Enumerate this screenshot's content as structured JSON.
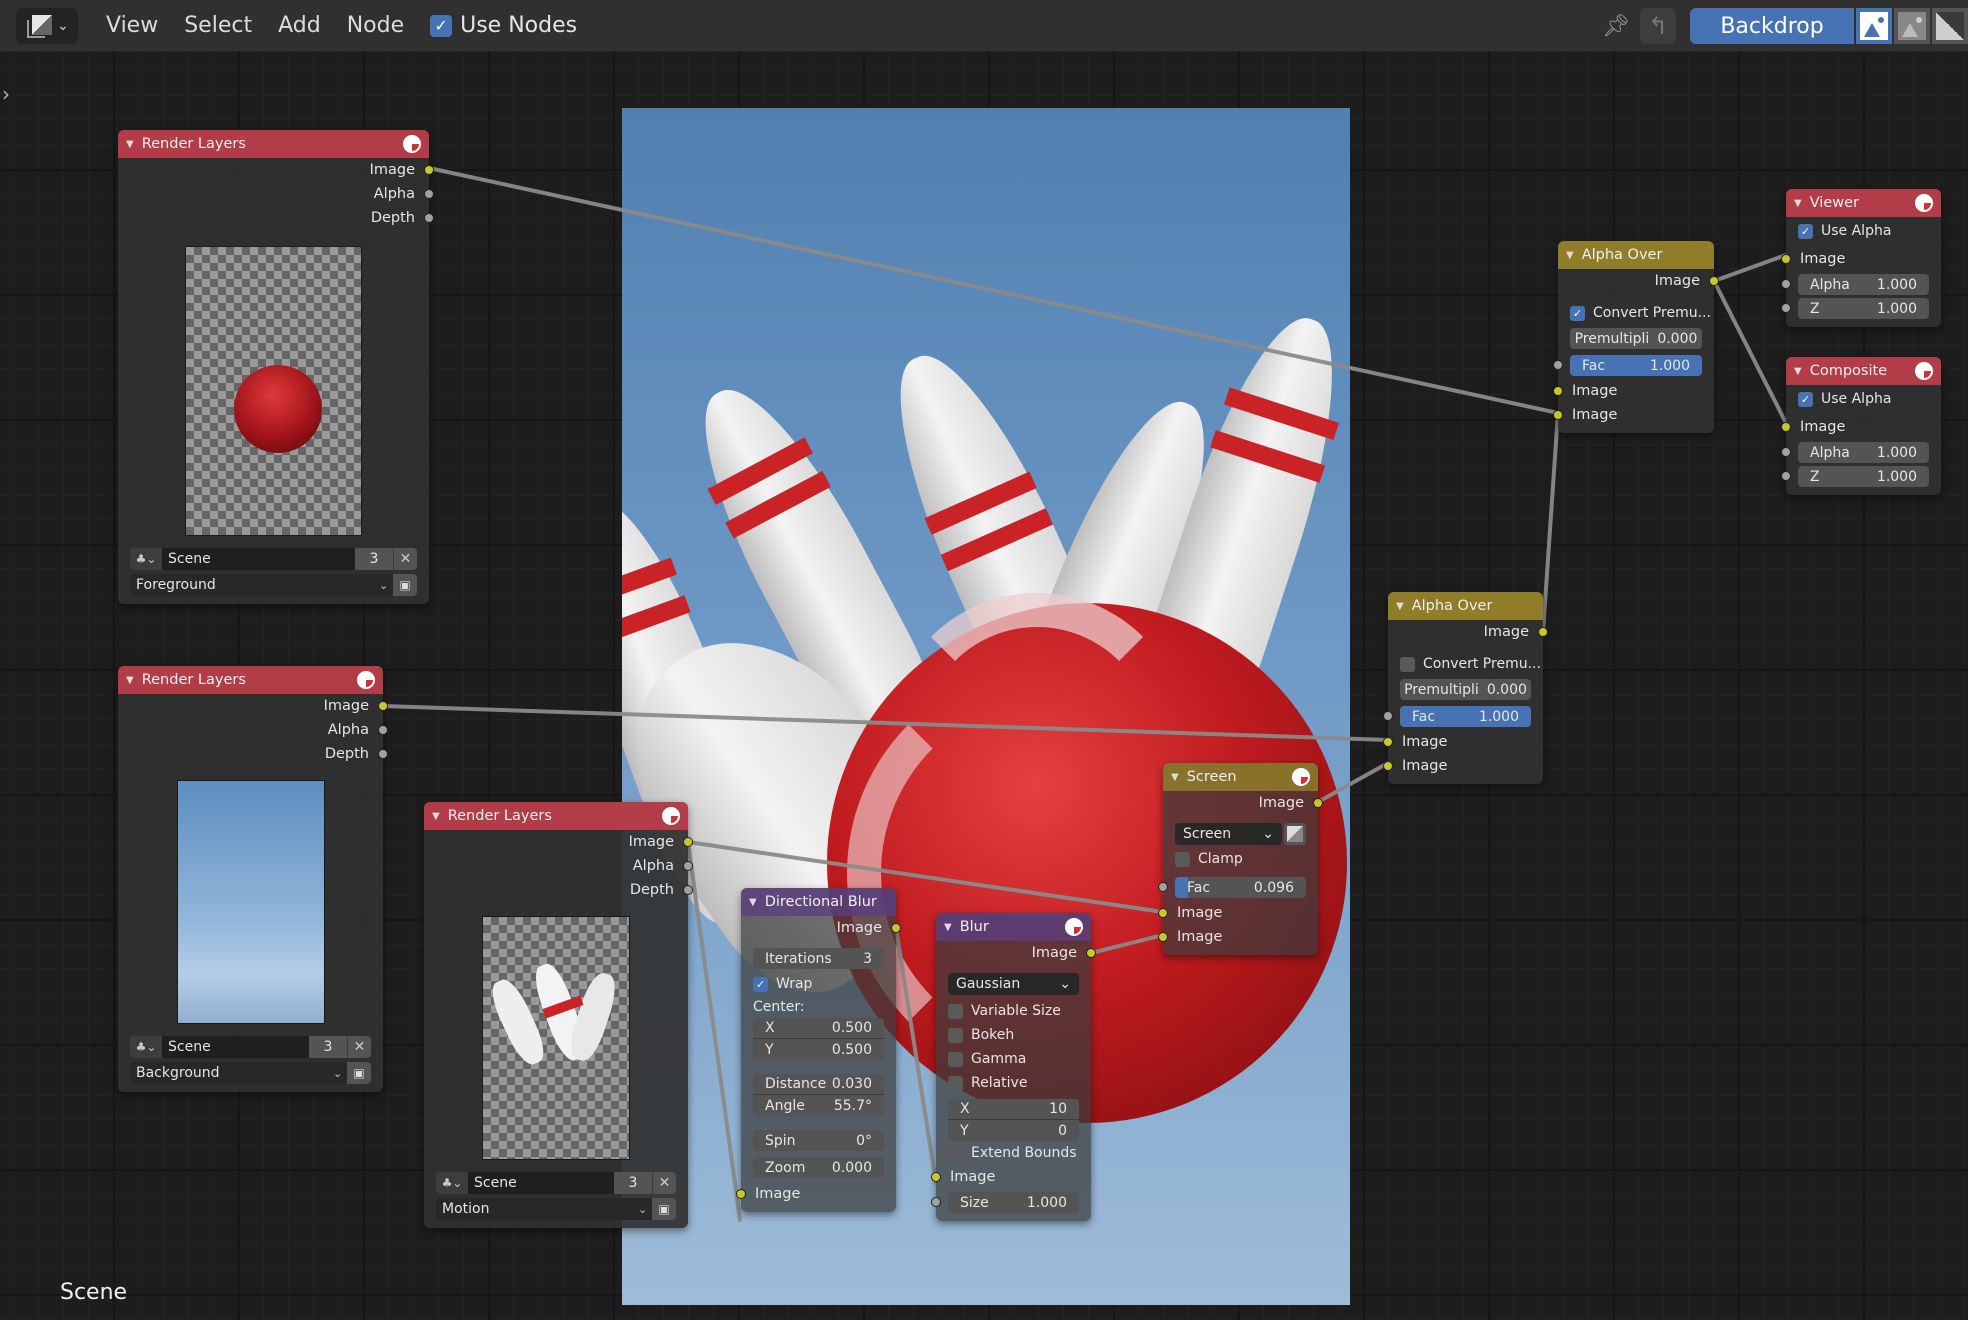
{
  "header": {
    "menus": [
      "View",
      "Select",
      "Add",
      "Node"
    ],
    "use_nodes_label": "Use Nodes",
    "use_nodes_checked": true,
    "backdrop_label": "Backdrop",
    "icons": [
      "editor-type-icon",
      "pin-icon",
      "parent-node-icon",
      "backdrop-channels-icon",
      "backdrop-alpha-icon",
      "backdrop-color-alpha-icon"
    ]
  },
  "footer": {
    "scene_label": "Scene"
  },
  "nodes": {
    "render_layers_1": {
      "title": "Render Layers",
      "outputs": [
        "Image",
        "Alpha",
        "Depth"
      ],
      "scene": "Scene",
      "scene_users": "3",
      "layer": "Foreground"
    },
    "render_layers_2": {
      "title": "Render Layers",
      "outputs": [
        "Image",
        "Alpha",
        "Depth"
      ],
      "scene": "Scene",
      "scene_users": "3",
      "layer": "Background"
    },
    "render_layers_3": {
      "title": "Render Layers",
      "outputs": [
        "Image",
        "Alpha",
        "Depth"
      ],
      "scene": "Scene",
      "scene_users": "3",
      "layer": "Motion"
    },
    "directional_blur": {
      "title": "Directional Blur",
      "output": "Image",
      "iterations_label": "Iterations",
      "iterations": "3",
      "wrap_label": "Wrap",
      "wrap_checked": true,
      "center_label": "Center:",
      "x_label": "X",
      "x": "0.500",
      "y_label": "Y",
      "y": "0.500",
      "distance_label": "Distance",
      "distance": "0.030",
      "angle_label": "Angle",
      "angle": "55.7°",
      "spin_label": "Spin",
      "spin": "0°",
      "zoom_label": "Zoom",
      "zoom": "0.000",
      "input": "Image"
    },
    "blur": {
      "title": "Blur",
      "output": "Image",
      "filter_type": "Gaussian",
      "variable_size_label": "Variable Size",
      "bokeh_label": "Bokeh",
      "gamma_label": "Gamma",
      "relative_label": "Relative",
      "x_label": "X",
      "x": "10",
      "y_label": "Y",
      "y": "0",
      "extend_bounds_label": "Extend Bounds",
      "input": "Image",
      "size_label": "Size",
      "size": "1.000"
    },
    "screen": {
      "title": "Screen",
      "output": "Image",
      "blend_mode": "Screen",
      "clamp_label": "Clamp",
      "fac_label": "Fac",
      "fac": "0.096",
      "fac_fraction": 0.096,
      "inputs": [
        "Image",
        "Image"
      ]
    },
    "alpha_over_1": {
      "title": "Alpha Over",
      "output": "Image",
      "convert_label": "Convert Premu...",
      "convert_checked": false,
      "premul_label": "Premultipli",
      "premul": "0.000",
      "fac_label": "Fac",
      "fac": "1.000",
      "inputs": [
        "Image",
        "Image"
      ]
    },
    "alpha_over_2": {
      "title": "Alpha Over",
      "output": "Image",
      "convert_label": "Convert Premu...",
      "convert_checked": true,
      "premul_label": "Premultipli",
      "premul": "0.000",
      "fac_label": "Fac",
      "fac": "1.000",
      "inputs": [
        "Image",
        "Image"
      ]
    },
    "viewer": {
      "title": "Viewer",
      "use_alpha_label": "Use Alpha",
      "use_alpha_checked": true,
      "input": "Image",
      "alpha_label": "Alpha",
      "alpha": "1.000",
      "z_label": "Z",
      "z": "1.000"
    },
    "composite": {
      "title": "Composite",
      "use_alpha_label": "Use Alpha",
      "use_alpha_checked": true,
      "input": "Image",
      "alpha_label": "Alpha",
      "alpha": "1.000",
      "z_label": "Z",
      "z": "1.000"
    }
  },
  "colors": {
    "accent": "#4772b3",
    "input_node_header": "#b33c49",
    "color_node_header": "#8f7d2a",
    "filter_node_header": "#5b3f80",
    "socket_color": "#c7c729",
    "socket_value": "#a1a1a1"
  }
}
